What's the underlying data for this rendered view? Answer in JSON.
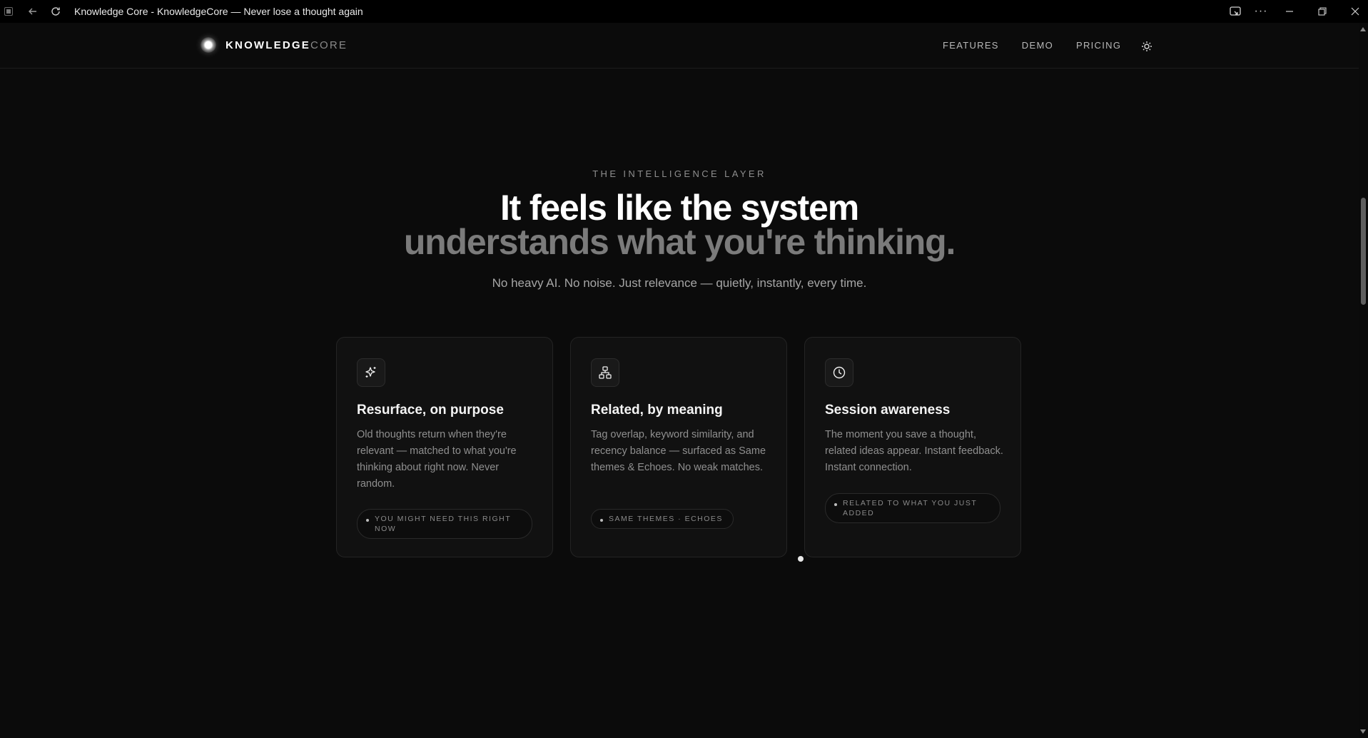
{
  "browser": {
    "title": "Knowledge Core - KnowledgeCore — Never lose a thought again",
    "more_label": "···"
  },
  "nav": {
    "logo_bold": "KNOWLEDGE",
    "logo_light": "CORE",
    "links": [
      "FEATURES",
      "DEMO",
      "PRICING"
    ],
    "theme_icon": "sun-icon"
  },
  "hero": {
    "eyebrow": "THE INTELLIGENCE LAYER",
    "headline_primary": "It feels like the system",
    "headline_secondary": "understands what you're thinking.",
    "subline": "No heavy AI. No noise. Just relevance — quietly, instantly, every time."
  },
  "cards": [
    {
      "icon": "sparkles-icon",
      "title": "Resurface, on purpose",
      "description": "Old thoughts return when they're relevant — matched to what you're thinking about right now. Never random.",
      "tag": "YOU MIGHT NEED THIS RIGHT NOW"
    },
    {
      "icon": "network-icon",
      "title": "Related, by meaning",
      "description": "Tag overlap, keyword similarity, and recency balance — surfaced as Same themes & Echoes. No weak matches.",
      "tag": "SAME THEMES · ECHOES"
    },
    {
      "icon": "clock-icon",
      "title": "Session awareness",
      "description": "The moment you save a thought, related ideas appear. Instant feedback. Instant connection.",
      "tag": "RELATED TO WHAT YOU JUST ADDED"
    }
  ]
}
